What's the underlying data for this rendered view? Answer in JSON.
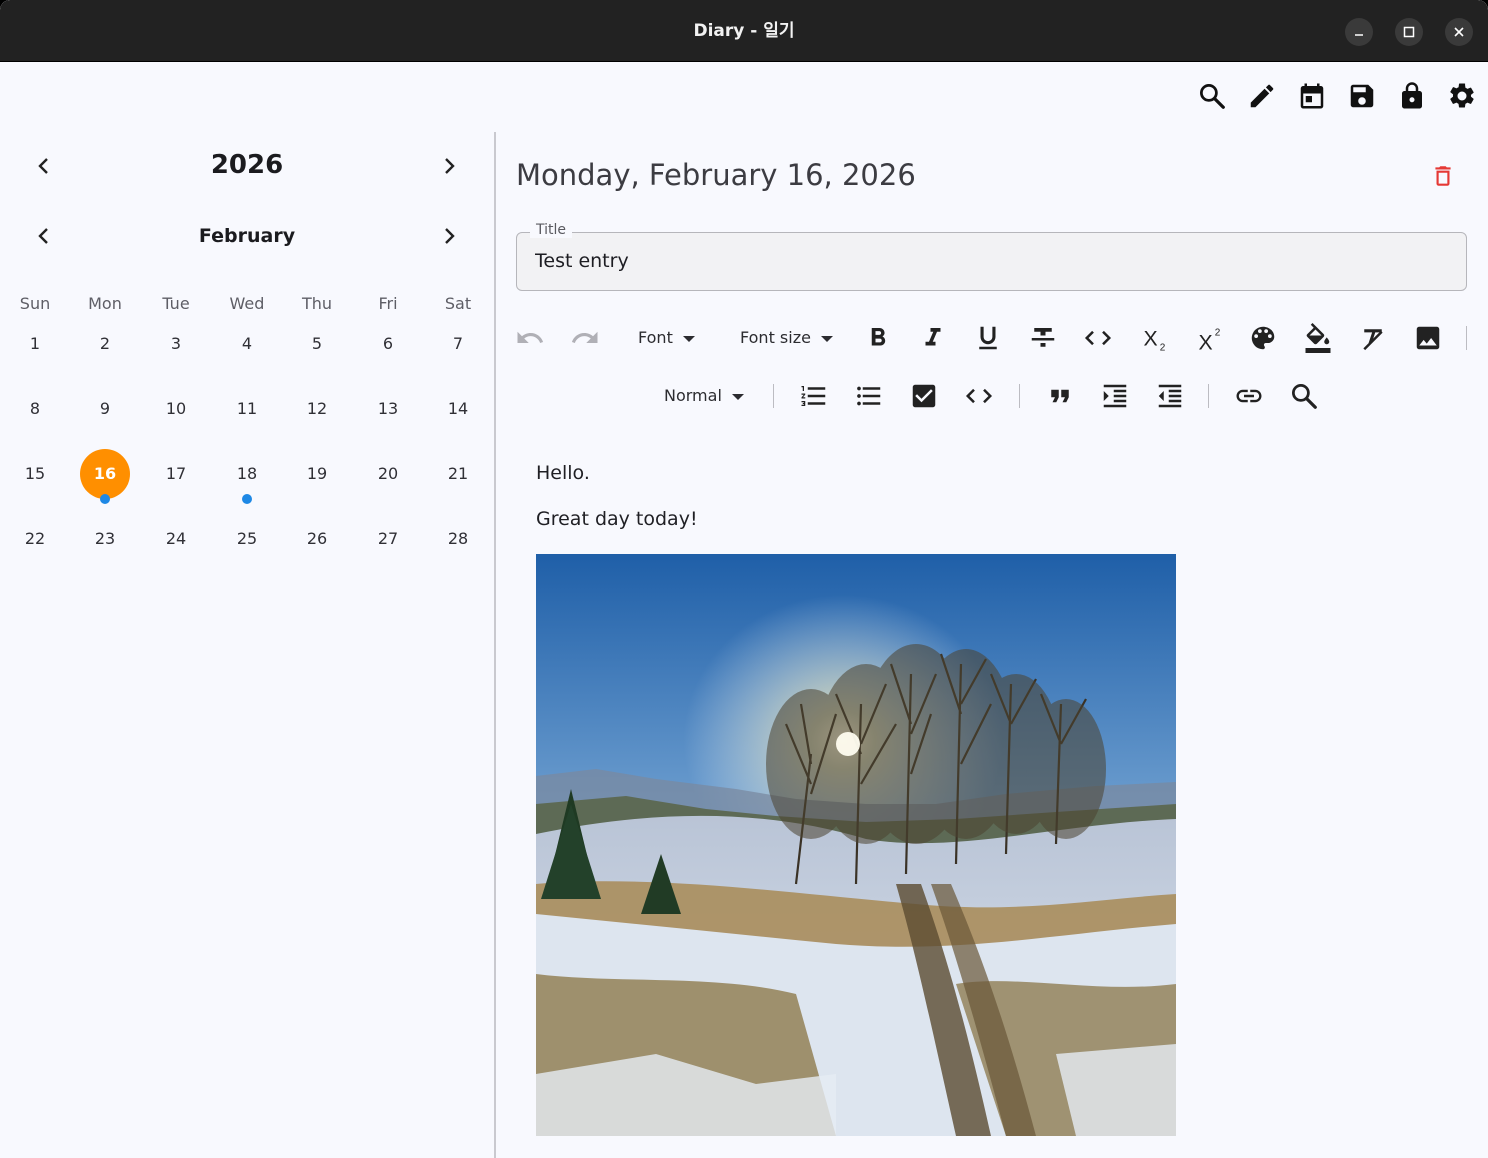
{
  "window": {
    "title": "Diary - 일기",
    "controls": [
      "minimize-icon",
      "maximize-icon",
      "close-icon"
    ]
  },
  "toolbar_top": {
    "icons": [
      "search-icon",
      "pencil-icon",
      "calendar-icon",
      "save-icon",
      "lock-icon",
      "gear-icon"
    ]
  },
  "calendar": {
    "year": "2026",
    "month": "February",
    "weekdays": [
      "Sun",
      "Mon",
      "Tue",
      "Wed",
      "Thu",
      "Fri",
      "Sat"
    ],
    "weeks": [
      [
        "1",
        "2",
        "3",
        "4",
        "5",
        "6",
        "7"
      ],
      [
        "8",
        "9",
        "10",
        "11",
        "12",
        "13",
        "14"
      ],
      [
        "15",
        "16",
        "17",
        "18",
        "19",
        "20",
        "21"
      ],
      [
        "22",
        "23",
        "24",
        "25",
        "26",
        "27",
        "28"
      ]
    ],
    "selected_day": "16",
    "days_with_entries": [
      "16",
      "18"
    ],
    "accent_color": "#ff8f00",
    "entry_dot_color": "#1e88e5"
  },
  "entry": {
    "date_heading": "Monday, February 16, 2026",
    "title_label": "Title",
    "title_value": "Test entry",
    "paragraphs": [
      "Hello.",
      "Great day today!"
    ],
    "delete_color": "#e53935"
  },
  "formatting": {
    "font_dropdown": "Font",
    "font_size_dropdown": "Font size",
    "block_style_dropdown": "Normal",
    "row1_icons": [
      "undo-icon",
      "redo-icon",
      "bold-icon",
      "italic-icon",
      "underline-icon",
      "strikethrough-icon",
      "inline-code-icon",
      "subscript-icon",
      "superscript-icon",
      "text-color-icon",
      "highlight-icon",
      "clear-format-icon",
      "image-icon"
    ],
    "row2_icons": [
      "numbered-list-icon",
      "bullet-list-icon",
      "checklist-icon",
      "code-block-icon",
      "quote-icon",
      "indent-icon",
      "outdent-icon",
      "link-icon",
      "search-icon"
    ]
  }
}
